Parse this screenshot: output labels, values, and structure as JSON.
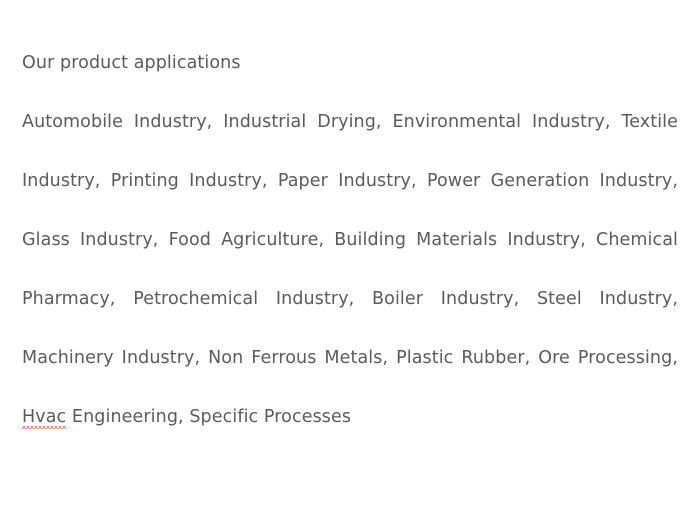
{
  "page": {
    "background_color": "#ffffff",
    "text_color": "#5b5b5b",
    "spellcheck_underline_color": "#e8685a"
  },
  "content": {
    "heading": "Our product applications",
    "paragraph_before_misspelling": "Automobile Industry, Industrial Drying, Environmental Industry, Textile Industry, Printing Industry, Paper Industry, Power Generation Industry, Glass Industry, Food Agriculture, Building Materials Industry, Chemical Pharmacy, Petrochemical Industry, Boiler Industry, Steel Industry, Machinery Industry, Non Ferrous Metals, Plastic Rubber, Ore Processing, ",
    "misspelled_word": "Hvac",
    "paragraph_after_misspelling": " Engineering, Specific Processes",
    "full_paragraph": "Automobile Industry, Industrial Drying, Environmental Industry, Textile Industry, Printing Industry, Paper Industry, Power Generation Industry, Glass Industry, Food Agriculture, Building Materials Industry, Chemical Pharmacy, Petrochemical Industry, Boiler Industry, Steel Industry, Machinery Industry, Non Ferrous Metals, Plastic Rubber, Ore Processing, Hvac Engineering, Specific Processes",
    "industries": [
      "Automobile Industry",
      "Industrial Drying",
      "Environmental Industry",
      "Textile Industry",
      "Printing Industry",
      "Paper Industry",
      "Power Generation Industry",
      "Glass Industry",
      "Food Agriculture",
      "Building Materials Industry",
      "Chemical Pharmacy",
      "Petrochemical Industry",
      "Boiler Industry",
      "Steel Industry",
      "Machinery Industry",
      "Non Ferrous Metals",
      "Plastic Rubber",
      "Ore Processing",
      "Hvac Engineering",
      "Specific Processes"
    ],
    "rendered_lines": [
      "Our product applications",
      "Automobile Industry, Industrial Drying, Environmental Industry,",
      "Textile Industry, Printing Industry, Paper Industry, Power",
      "Generation Industry, Glass Industry, Food Agriculture, Building",
      "Materials Industry, Chemical Pharmacy, Petrochemical Industry,",
      "Boiler Industry, Steel Industry, Machinery Industry, Non Ferrous",
      "Metals, Plastic Rubber, Ore Processing, Hvac Engineering,",
      "Specific Processes"
    ]
  }
}
